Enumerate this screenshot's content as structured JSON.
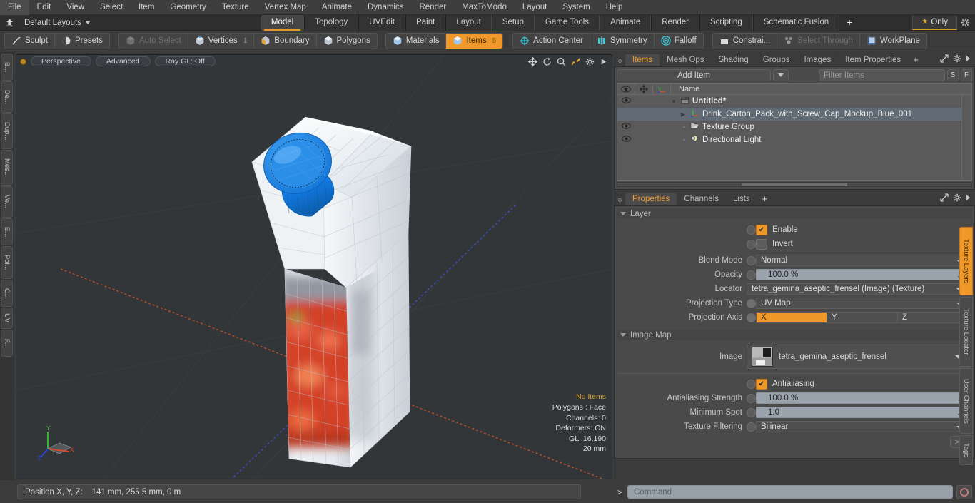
{
  "menubar": {
    "items": [
      "File",
      "Edit",
      "View",
      "Select",
      "Item",
      "Geometry",
      "Texture",
      "Vertex Map",
      "Animate",
      "Dynamics",
      "Render",
      "MaxToModo",
      "Layout",
      "System",
      "Help"
    ]
  },
  "layoutbar": {
    "home_icon": "home-icon",
    "layout_label": "Default Layouts",
    "tabs": [
      {
        "label": "Model",
        "active": true
      },
      {
        "label": "Topology",
        "active": false
      },
      {
        "label": "UVEdit",
        "active": false
      },
      {
        "label": "Paint",
        "active": false
      },
      {
        "label": "Layout",
        "active": false
      },
      {
        "label": "Setup",
        "active": false
      },
      {
        "label": "Game Tools",
        "active": false
      },
      {
        "label": "Animate",
        "active": false
      },
      {
        "label": "Render",
        "active": false
      },
      {
        "label": "Scripting",
        "active": false
      },
      {
        "label": "Schematic Fusion",
        "active": false
      }
    ],
    "add_tab_label": "+",
    "only_label": "Only",
    "gear_icon": "gear-icon"
  },
  "toolbar": {
    "group1": [
      {
        "label": "Sculpt",
        "icon": "sculpt-icon",
        "state": "normal"
      },
      {
        "label": "Presets",
        "icon": "presets-icon",
        "state": "normal"
      }
    ],
    "group2": [
      {
        "label": "Auto Select",
        "icon": "cube-icon",
        "state": "dim",
        "count": ""
      },
      {
        "label": "Vertices",
        "icon": "vertex-icon",
        "state": "normal",
        "count": "1"
      },
      {
        "label": "Boundary",
        "icon": "boundary-icon",
        "state": "normal",
        "count": ""
      },
      {
        "label": "Polygons",
        "icon": "polygon-icon",
        "state": "normal",
        "count": ""
      }
    ],
    "group3": [
      {
        "label": "Materials",
        "icon": "material-icon",
        "state": "normal",
        "count": ""
      },
      {
        "label": "Items",
        "icon": "items-icon",
        "state": "active",
        "count": "5"
      }
    ],
    "group4": [
      {
        "label": "Action Center",
        "icon": "action-center-icon",
        "state": "normal"
      },
      {
        "label": "Symmetry",
        "icon": "symmetry-icon",
        "state": "normal"
      },
      {
        "label": "Falloff",
        "icon": "falloff-icon",
        "state": "normal"
      }
    ],
    "group5": [
      {
        "label": "Constrai...",
        "icon": "constraint-icon",
        "state": "normal"
      },
      {
        "label": "Select Through",
        "icon": "select-through-icon",
        "state": "dim"
      },
      {
        "label": "WorkPlane",
        "icon": "workplane-icon",
        "state": "normal"
      }
    ]
  },
  "left_tabs": [
    "B...",
    "De...",
    "Dup...",
    "Mes...",
    "Ve...",
    "E...",
    "Pol...",
    "C...",
    "UV",
    "F..."
  ],
  "viewport": {
    "dot": "view-indicator",
    "pills": [
      "Perspective",
      "Advanced",
      "Ray GL: Off"
    ],
    "tool_icons": [
      "move-icon",
      "rotate-icon",
      "zoom-icon",
      "fit-icon",
      "gear-icon",
      "play-icon"
    ],
    "info": {
      "selection": "No Items",
      "polygons": "Polygons : Face",
      "channels": "Channels: 0",
      "deformers": "Deformers: ON",
      "gl": "GL: 16,190",
      "scale": "20 mm"
    },
    "gizmo_axes": [
      "X",
      "Y",
      "Z"
    ],
    "background_color": "#333638"
  },
  "items_panel": {
    "tabs": [
      {
        "label": "Items",
        "active": true
      },
      {
        "label": "Mesh Ops",
        "active": false
      },
      {
        "label": "Shading",
        "active": false
      },
      {
        "label": "Groups",
        "active": false
      },
      {
        "label": "Images",
        "active": false
      },
      {
        "label": "Item Properties",
        "active": false
      }
    ],
    "add_tab_label": "+",
    "add_item_label": "Add Item",
    "filter_placeholder": "Filter Items",
    "btn_s": "S",
    "btn_f": "F",
    "columns": [
      "eye-icon",
      "move-icon",
      "axis-icon",
      "Name"
    ],
    "rows": [
      {
        "name": "Untitled*",
        "indent": 0,
        "eye": true,
        "bold": true,
        "arrow": "open",
        "icon": "scene-icon",
        "selected": false
      },
      {
        "name": "Drink_Carton_Pack_with_Screw_Cap_Mockup_Blue_001",
        "indent": 1,
        "eye": false,
        "bold": false,
        "arrow": "closed",
        "icon": "mesh-icon",
        "selected": true
      },
      {
        "name": "Texture Group",
        "indent": 1,
        "eye": true,
        "bold": false,
        "arrow": "none",
        "icon": "texture-group-icon",
        "selected": false
      },
      {
        "name": "Directional Light",
        "indent": 1,
        "eye": true,
        "bold": false,
        "arrow": "none",
        "icon": "light-icon",
        "selected": false
      }
    ]
  },
  "properties_panel": {
    "tabs": [
      {
        "label": "Properties",
        "active": true
      },
      {
        "label": "Channels",
        "active": false
      },
      {
        "label": "Lists",
        "active": false
      }
    ],
    "add_tab_label": "+",
    "layer_section": {
      "title": "Layer",
      "enable_label": "Enable",
      "enable_checked": true,
      "invert_label": "Invert",
      "invert_checked": false,
      "fields": [
        {
          "label": "Blend Mode",
          "value": "Normal",
          "type": "dropdown",
          "knob": true
        },
        {
          "label": "Opacity",
          "value": "100.0 %",
          "type": "slider",
          "knob": true
        },
        {
          "label": "Locator",
          "value": "tetra_gemina_aseptic_frensel (Image) (Texture)",
          "type": "dropdown",
          "knob": false
        },
        {
          "label": "Projection Type",
          "value": "UV Map",
          "type": "dropdown",
          "knob": true
        }
      ],
      "projection_axis": {
        "label": "Projection Axis",
        "options": [
          "X",
          "Y",
          "Z"
        ],
        "selected": "X"
      }
    },
    "image_map_section": {
      "title": "Image Map",
      "image_label": "Image",
      "image_value": "tetra_gemina_aseptic_frensel",
      "antialiasing_label": "Antialiasing",
      "antialiasing_checked": true,
      "fields": [
        {
          "label": "Antialiasing Strength",
          "value": "100.0 %",
          "type": "slider"
        },
        {
          "label": "Minimum Spot",
          "value": "1.0",
          "type": "slider"
        },
        {
          "label": "Texture Filtering",
          "value": "Bilinear",
          "type": "dropdown"
        }
      ],
      "more_button": ">>"
    }
  },
  "right_tabs": [
    {
      "label": "Texture Layers",
      "active": true
    },
    {
      "label": "Texture Locator",
      "active": false
    },
    {
      "label": "User Channels",
      "active": false
    },
    {
      "label": "Tags",
      "active": false
    }
  ],
  "statusbar": {
    "position_label": "Position X, Y, Z:",
    "position_value": "141 mm, 255.5 mm, 0 m",
    "command_prompt": ">",
    "command_placeholder": "Command",
    "record_icon": "record-icon"
  },
  "colors": {
    "accent": "#f0982a",
    "panel": "#4a4a4a",
    "bg": "#3b3b3b",
    "viewport": "#333638",
    "cap_blue": "#1b7fe0"
  }
}
